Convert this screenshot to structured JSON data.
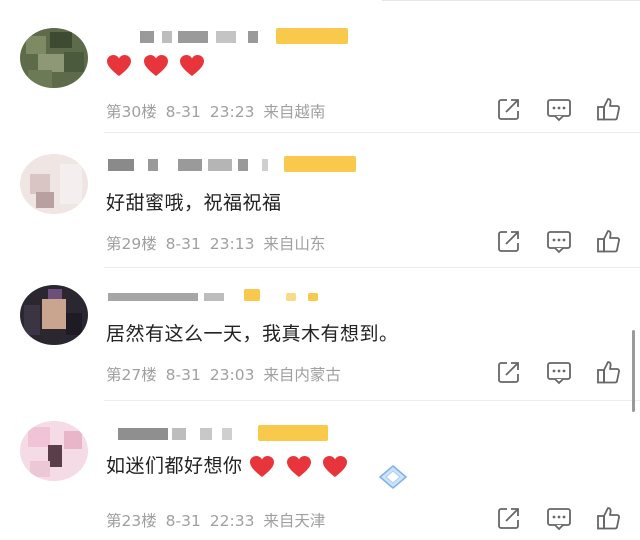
{
  "colors": {
    "heart": "#e8353b",
    "meta": "#a0a0a0",
    "vip": "#f8c94a"
  },
  "comments": [
    {
      "id": "c30",
      "text": "",
      "hearts": 3,
      "floor": "第30楼",
      "date": "8-31",
      "time": "23:23",
      "location": "来自越南"
    },
    {
      "id": "c29",
      "text": "好甜蜜哦，祝福祝福",
      "hearts": 0,
      "floor": "第29楼",
      "date": "8-31",
      "time": "23:13",
      "location": "来自山东"
    },
    {
      "id": "c27",
      "text": "居然有这么一天，我真木有想到。",
      "hearts": 0,
      "floor": "第27楼",
      "date": "8-31",
      "time": "23:03",
      "location": "来自内蒙古"
    },
    {
      "id": "c23",
      "text": "如迷们都好想你",
      "hearts": 3,
      "floor": "第23楼",
      "date": "8-31",
      "time": "22:33",
      "location": "来自天津"
    }
  ],
  "icons": {
    "share": "share-icon",
    "reply": "comment-icon",
    "like": "like-icon",
    "badge": "diamond-badge-icon"
  }
}
